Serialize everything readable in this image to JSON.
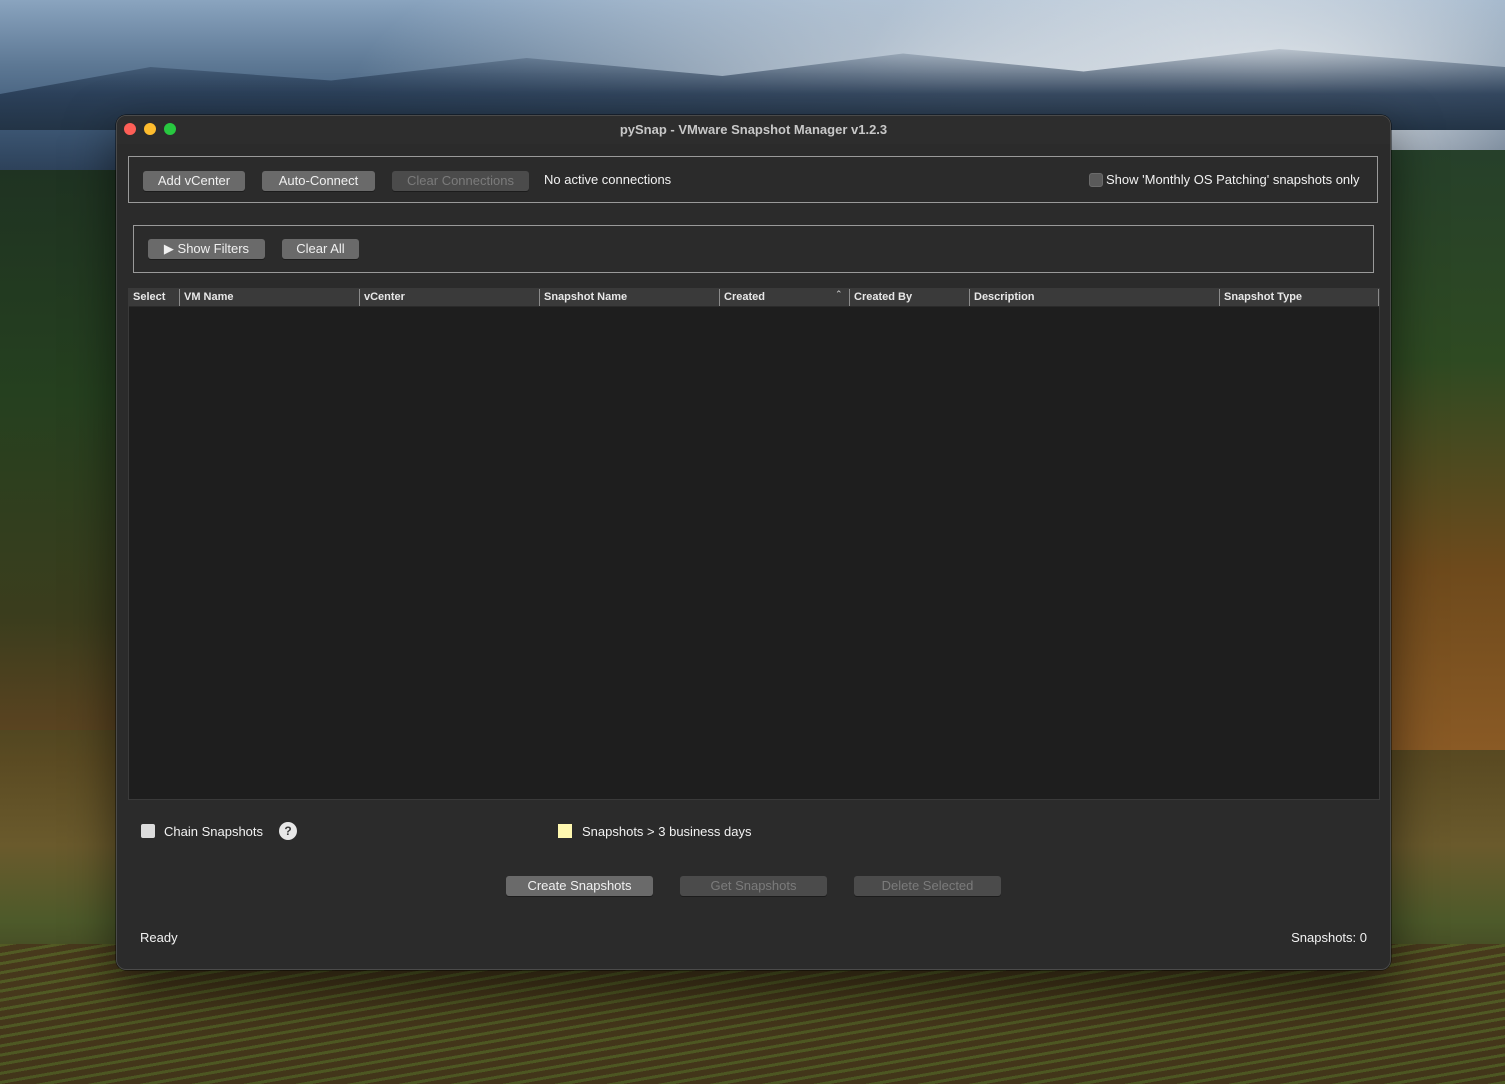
{
  "window": {
    "title": "pySnap - VMware Snapshot Manager v1.2.3"
  },
  "connection": {
    "add_vcenter_label": "Add vCenter",
    "auto_connect_label": "Auto-Connect",
    "clear_connections_label": "Clear Connections",
    "status_text": "No active connections",
    "monthly_patching_label": "Show 'Monthly OS Patching' snapshots only",
    "monthly_patching_checked": false
  },
  "filters": {
    "show_filters_label": "▶ Show Filters",
    "clear_all_label": "Clear All"
  },
  "table": {
    "columns": [
      "Select",
      "VM Name",
      "vCenter",
      "Snapshot Name",
      "Created",
      "Created By",
      "Description",
      "Snapshot Type"
    ],
    "sort_column": "Created",
    "sort_indicator": "⌃",
    "rows": []
  },
  "options": {
    "chain_snapshots_label": "Chain Snapshots",
    "chain_snapshots_checked": false,
    "help_icon_glyph": "?",
    "legend_label": "Snapshots > 3 business days",
    "legend_color": "#fff8b0"
  },
  "actions": {
    "create_label": "Create Snapshots",
    "get_label": "Get Snapshots",
    "delete_label": "Delete Selected"
  },
  "status": {
    "left_text": "Ready",
    "right_text": "Snapshots: 0"
  },
  "colors": {
    "close": "#fe5f57",
    "minimize": "#febc2e",
    "maximize": "#28c840"
  }
}
